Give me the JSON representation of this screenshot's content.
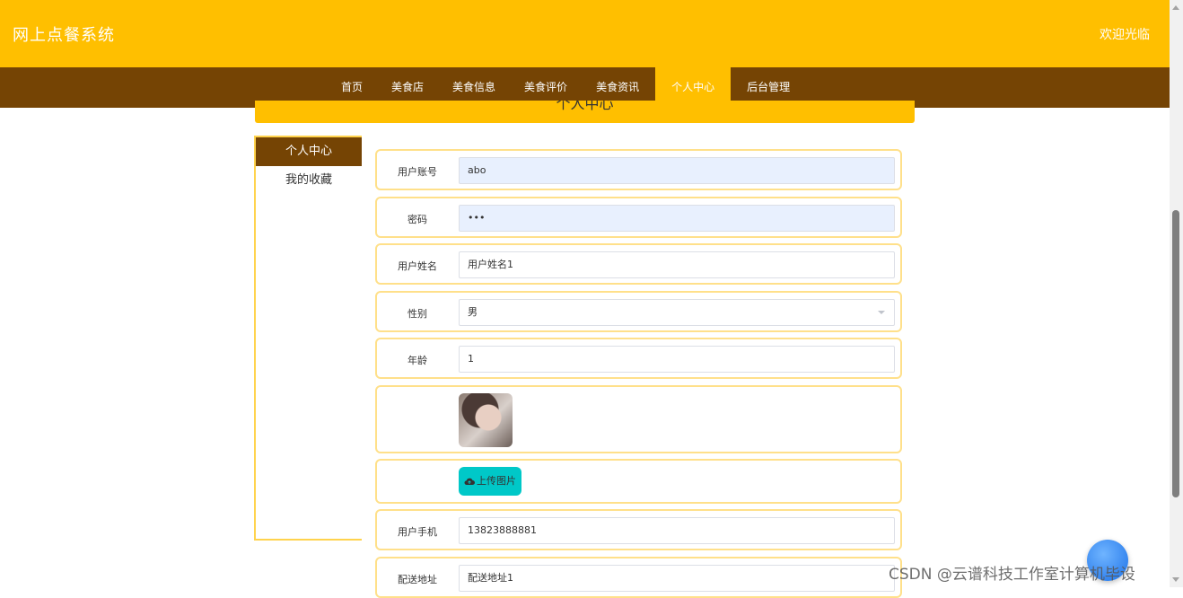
{
  "header": {
    "site_title": "网上点餐系统",
    "welcome": "欢迎光临"
  },
  "nav": {
    "items": [
      {
        "label": "首页",
        "active": false
      },
      {
        "label": "美食店",
        "active": false
      },
      {
        "label": "美食信息",
        "active": false
      },
      {
        "label": "美食评价",
        "active": false
      },
      {
        "label": "美食资讯",
        "active": false
      },
      {
        "label": "个人中心",
        "active": true
      },
      {
        "label": "后台管理",
        "active": false
      }
    ]
  },
  "banner": {
    "title": "个人中心"
  },
  "sidebar": {
    "items": [
      {
        "label": "个人中心",
        "active": true
      },
      {
        "label": "我的收藏",
        "active": false
      }
    ]
  },
  "form": {
    "account": {
      "label": "用户账号",
      "value": "abo"
    },
    "password": {
      "label": "密码",
      "value": "•••"
    },
    "name": {
      "label": "用户姓名",
      "value": "用户姓名1"
    },
    "gender": {
      "label": "性别",
      "value": "男"
    },
    "age": {
      "label": "年龄",
      "value": "1"
    },
    "upload_label": "上传图片",
    "phone": {
      "label": "用户手机",
      "value": "13823888881"
    },
    "address": {
      "label": "配送地址",
      "value": "配送地址1"
    }
  },
  "watermark": "CSDN @云谱科技工作室计算机毕设",
  "colors": {
    "primary": "#ffbf00",
    "nav_bg": "#754404",
    "upload_button": "#00c8c8",
    "autofill": "#e8f0fe"
  }
}
